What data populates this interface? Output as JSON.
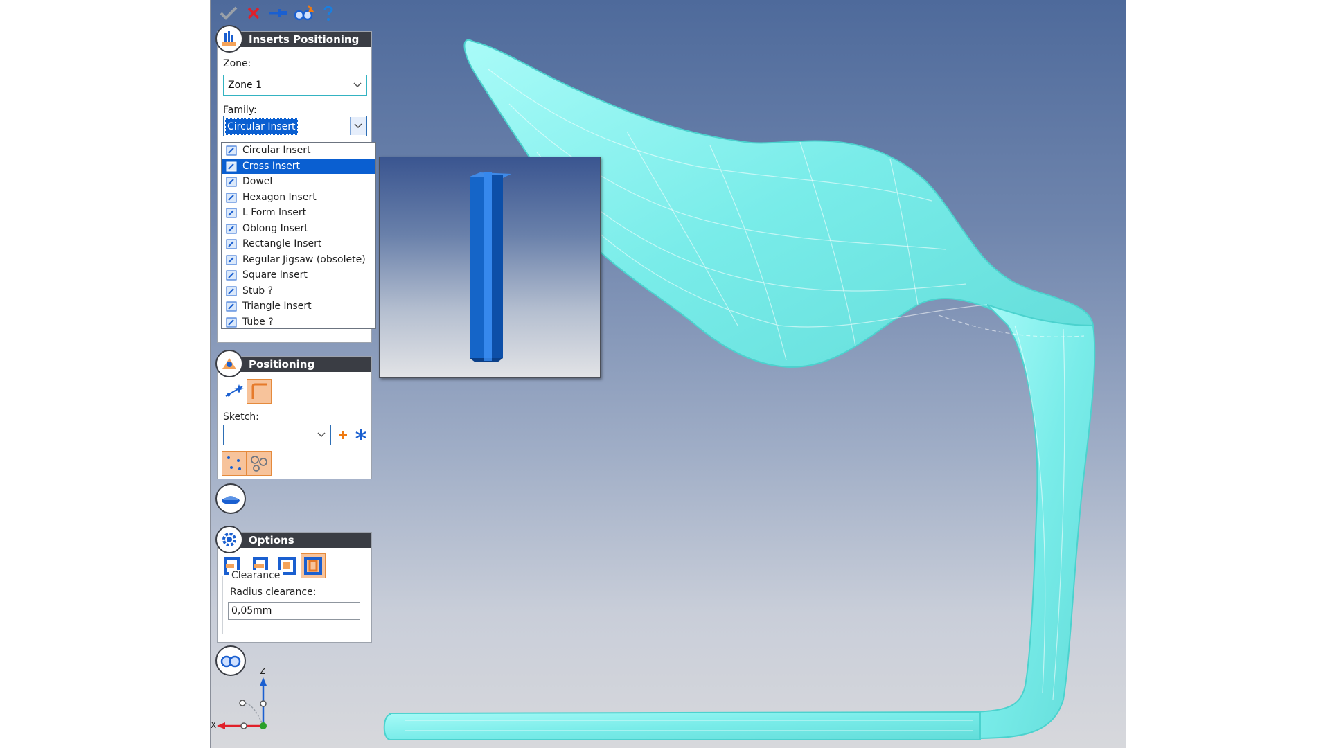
{
  "toolbar": {
    "items": [
      {
        "name": "ok",
        "icon": "checkmark-icon"
      },
      {
        "name": "cancel",
        "icon": "close-icon"
      },
      {
        "name": "pin",
        "icon": "pushpin-icon"
      },
      {
        "name": "preview",
        "icon": "glasses-icon"
      },
      {
        "name": "help",
        "icon": "question-icon"
      }
    ]
  },
  "inserts_panel": {
    "title": "Inserts Positioning",
    "zone_label": "Zone:",
    "zone_value": "Zone 1",
    "family_label": "Family:",
    "family_value": "Circular Insert"
  },
  "family_dropdown": {
    "options": [
      "Circular Insert",
      "Cross Insert",
      "Dowel",
      "Hexagon Insert",
      "L Form Insert",
      "Oblong Insert",
      "Rectangle Insert",
      "Regular Jigsaw (obsolete)",
      "Square Insert",
      "Stub ?",
      "Triangle Insert",
      "Tube ?"
    ],
    "highlighted": "Cross Insert"
  },
  "positioning_panel": {
    "title": "Positioning",
    "sketch_label": "Sketch:",
    "sketch_value": ""
  },
  "options_panel": {
    "title": "Options",
    "clearance_title": "Clearance",
    "radius_label": "Radius clearance:",
    "radius_value": "0,05mm"
  },
  "axis": {
    "z": "Z",
    "x": "X"
  },
  "colors": {
    "model": "#7ef0ec",
    "selection": "#0a5fd1",
    "panel_header": "#3a3d44",
    "accent_orange": "#f7c39b",
    "insert_blue": "#1565c8"
  }
}
